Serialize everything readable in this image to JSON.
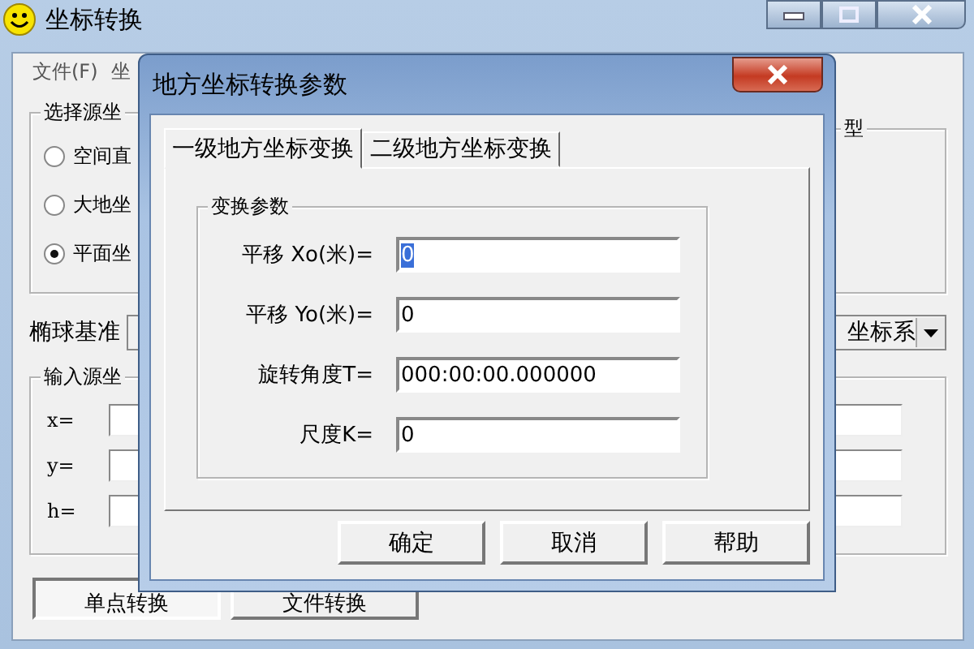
{
  "main_window": {
    "title": "坐标转换",
    "menu": [
      "文件(F)",
      "坐"
    ],
    "source_group": {
      "label": "选择源坐",
      "options": [
        {
          "label": "空间直",
          "selected": false
        },
        {
          "label": "大地坐",
          "selected": false
        },
        {
          "label": "平面坐",
          "selected": true
        }
      ]
    },
    "type_group": {
      "label": "型"
    },
    "ellipsoid": {
      "label": "椭球基准",
      "value": "坐标系"
    },
    "input_group": {
      "label": "输入源坐",
      "fields": [
        {
          "label": "x="
        },
        {
          "label": "y="
        },
        {
          "label": "h="
        }
      ]
    },
    "mode_buttons": [
      {
        "label": "单点转换",
        "selected": true
      },
      {
        "label": "文件转换",
        "selected": false
      }
    ]
  },
  "dialog": {
    "title": "地方坐标转换参数",
    "tabs": [
      {
        "label": "一级地方坐标变换",
        "selected": true
      },
      {
        "label": "二级地方坐标变换",
        "selected": false
      }
    ],
    "group": "变换参数",
    "fields": [
      {
        "label": "平移 Xo(米)=",
        "value": "0",
        "selected": true
      },
      {
        "label": "平移 Yo(米)=",
        "value": "0",
        "selected": false
      },
      {
        "label": "旋转角度T=",
        "value": "000:00:00.000000",
        "selected": false
      },
      {
        "label": "尺度K=",
        "value": "0",
        "selected": false
      }
    ],
    "buttons": [
      "确定",
      "取消",
      "帮助"
    ]
  }
}
